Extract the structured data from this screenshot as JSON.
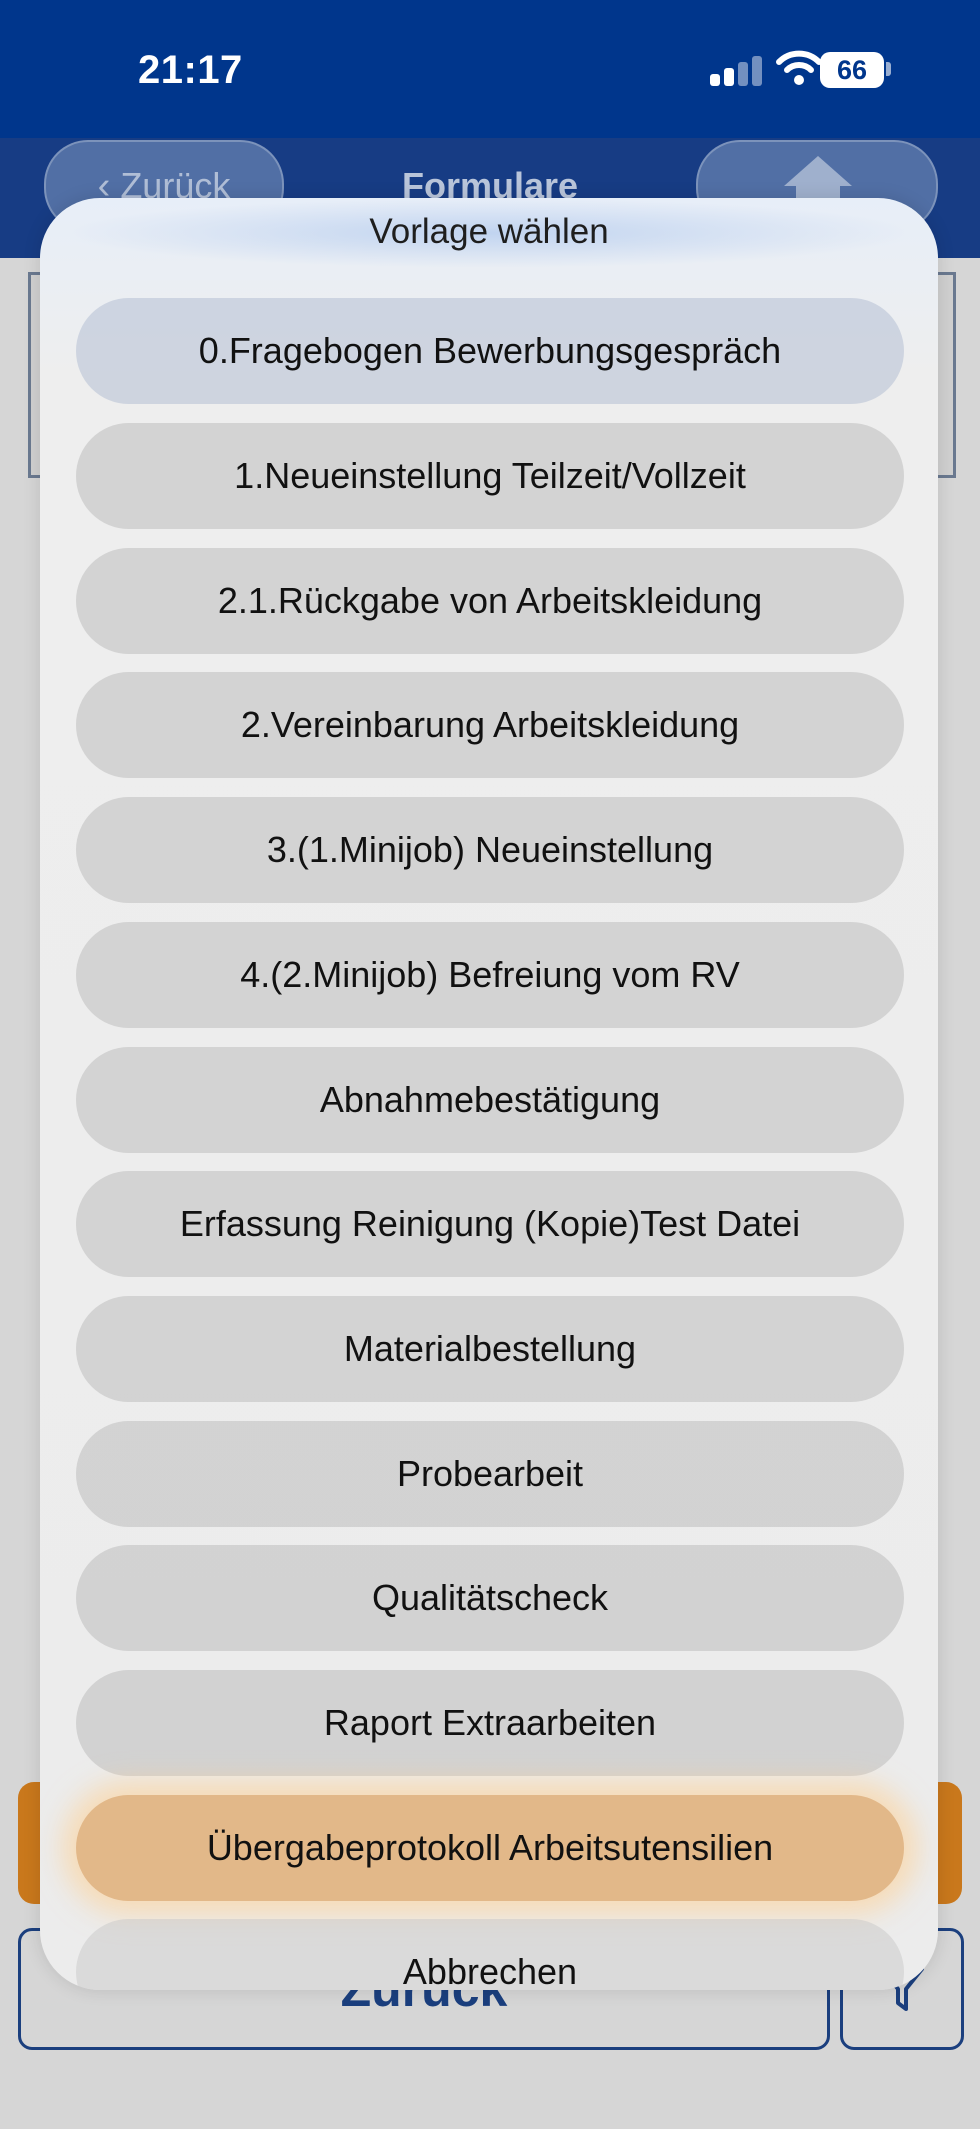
{
  "status_bar": {
    "time": "21:17",
    "battery": "66",
    "icons": [
      "cellular-signal-icon",
      "wifi-icon",
      "battery-icon"
    ]
  },
  "nav": {
    "back_label": "Zurück",
    "title": "Formulare",
    "home_icon": "home-icon"
  },
  "background": {
    "zurueck_label": "Zurück",
    "filter_icon": "filter-icon",
    "accent_orange": "#c9781c",
    "brand_blue": "#00368c"
  },
  "sheet": {
    "title": "Vorlage wählen",
    "options": [
      "0.Fragebogen Bewerbungsgespräch",
      "1.Neueinstellung Teilzeit/Vollzeit",
      "2.1.Rückgabe von Arbeitskleidung",
      "2.Vereinbarung Arbeitskleidung",
      "3.(1.Minijob) Neueinstellung",
      "4.(2.Minijob) Befreiung vom RV",
      "Abnahmebestätigung",
      "Erfassung Reinigung  (Kopie)Test Datei",
      "Materialbestellung",
      "Probearbeit",
      "Qualitätscheck",
      "Raport Extraarbeiten",
      "Übergabeprotokoll Arbeitsutensilien"
    ],
    "highlighted_option": "Übergabeprotokoll Arbeitsutensilien",
    "cancel_label": "Abbrechen"
  }
}
